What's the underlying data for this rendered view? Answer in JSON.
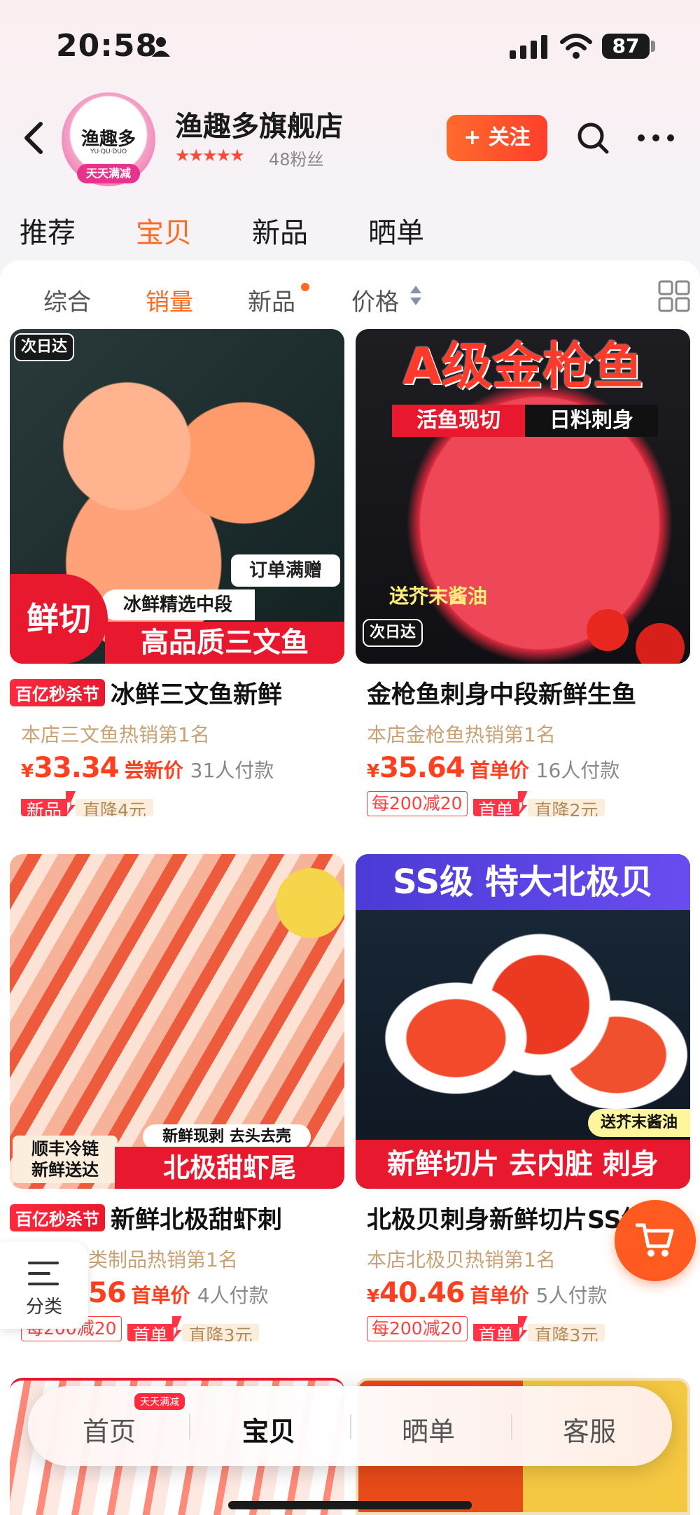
{
  "status_bar": {
    "time": "20:58",
    "battery": "87"
  },
  "shop": {
    "logo_title": "渔趣多",
    "logo_sub": "YU·QU·DUO",
    "logo_ribbon": "天天满减",
    "name": "渔趣多旗舰店",
    "stars": "★★★★★",
    "fans": "48粉丝",
    "follow_label": "+ 关注"
  },
  "tabs": [
    "推荐",
    "宝贝",
    "新品",
    "晒单"
  ],
  "sort": {
    "items": [
      "综合",
      "销量",
      "新品",
      "价格"
    ]
  },
  "products": [
    {
      "img_badge": "次日达",
      "img_top_text": "订单满赠",
      "img_mid_text": "冰鲜精选中段",
      "img_side_text": "鲜切",
      "img_bottom_text": "高品质三文鱼",
      "promo": "百亿秒杀节",
      "title": "冰鲜三文鱼新鲜",
      "rank": "本店三文鱼热销第1名",
      "currency": "¥",
      "price": "33.34",
      "price_note": "尝新价",
      "paid": "31人付款",
      "tags": [
        {
          "left": "新品",
          "right": "直降4元"
        }
      ],
      "colors": {
        "base": "#f48a5b",
        "dark": "#1d2a2a"
      }
    },
    {
      "img_top_text": "A级金枪鱼",
      "img_sub1": "活鱼现切",
      "img_sub2": "日料刺身",
      "img_mid_text": "送芥末酱油",
      "img_badge": "次日达",
      "title": "金枪鱼刺身中段新鲜生鱼",
      "rank": "本店金枪鱼热销第1名",
      "currency": "¥",
      "price": "35.64",
      "price_note": "首单价",
      "paid": "16人付款",
      "coupon": "每200减20",
      "tags": [
        {
          "left": "首单",
          "right": "直降2元"
        }
      ],
      "colors": {
        "base": "#e8394a",
        "dark": "#1a1a1a"
      }
    },
    {
      "img_badge1": "顺丰冷链",
      "img_badge2": "新鲜送达",
      "img_mid_text": "新鲜现剥 去头去壳",
      "img_bottom_text": "北极甜虾尾",
      "promo": "百亿秒杀节",
      "title": "新鲜北极甜虾刺",
      "rank": "类制品热销第1名",
      "price": "56",
      "price_note": "首单价",
      "paid": "4人付款",
      "coupon": "每200减20",
      "tags": [
        {
          "left": "首单",
          "right": "直降3元"
        }
      ],
      "colors": {
        "base": "#f1684a",
        "dark": "#eef0f2"
      }
    },
    {
      "img_top_text": "SS级 特大北极贝",
      "img_mid_text": "送芥末酱油",
      "img_bottom_text": "新鲜切片 去内脏 刺身",
      "title": "北极贝刺身新鲜切片SS级",
      "rank": "本店北极贝热销第1名",
      "currency": "¥",
      "price": "40.46",
      "price_note": "首单价",
      "paid": "5人付款",
      "coupon": "每200减20",
      "tags": [
        {
          "left": "首单",
          "right": "直降3元"
        }
      ],
      "colors": {
        "base": "#e4402e",
        "dark": "#1a2a3a"
      }
    }
  ],
  "side": {
    "category_label": "分类"
  },
  "bottom_nav": {
    "items": [
      "首页",
      "宝贝",
      "晒单",
      "客服"
    ],
    "badge": "天天满减"
  }
}
